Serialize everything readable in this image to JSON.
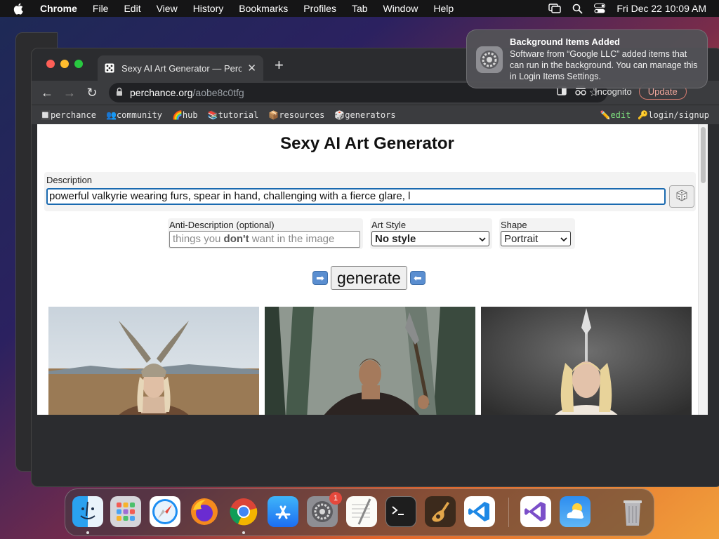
{
  "menubar": {
    "app": "Chrome",
    "items": [
      "File",
      "Edit",
      "View",
      "History",
      "Bookmarks",
      "Profiles",
      "Tab",
      "Window",
      "Help"
    ],
    "datetime": "Fri Dec 22  10:09 AM"
  },
  "browser": {
    "tab_title": "Sexy AI Art Generator — Perchance",
    "url_host": "perchance.org",
    "url_path": "/aobe8c0tfg",
    "profile_label": "Incognito",
    "update_label": "Update",
    "bookmarks": [
      {
        "icon": "🔲",
        "label": "perchance"
      },
      {
        "icon": "👥",
        "label": "community"
      },
      {
        "icon": "🌈",
        "label": "hub"
      },
      {
        "icon": "📚",
        "label": "tutorial"
      },
      {
        "icon": "📦",
        "label": "resources"
      },
      {
        "icon": "🎲",
        "label": "generators"
      }
    ],
    "edit_label": "edit",
    "login_label": "login/signup"
  },
  "page": {
    "title": "Sexy AI Art Generator",
    "description_label": "Description",
    "description_value": "powerful valkyrie wearing furs, spear in hand, challenging with a fierce glare, l",
    "anti_label": "Anti-Description (optional)",
    "anti_placeholder_pre": "things you ",
    "anti_placeholder_bold": "don't",
    "anti_placeholder_post": " want in the image",
    "artstyle_label": "Art Style",
    "artstyle_value": "No style",
    "shape_label": "Shape",
    "shape_value": "Portrait",
    "generate_label": "generate"
  },
  "notification": {
    "title": "Background Items Added",
    "body": "Software from “Google LLC” added items that can run in the background. You can manage this in Login Items Settings."
  },
  "dock": {
    "settings_badge": "1"
  },
  "colors": {
    "accent": "#1a6ab0",
    "menubar": "#151516",
    "chrome_frame": "#2b2c2f"
  }
}
